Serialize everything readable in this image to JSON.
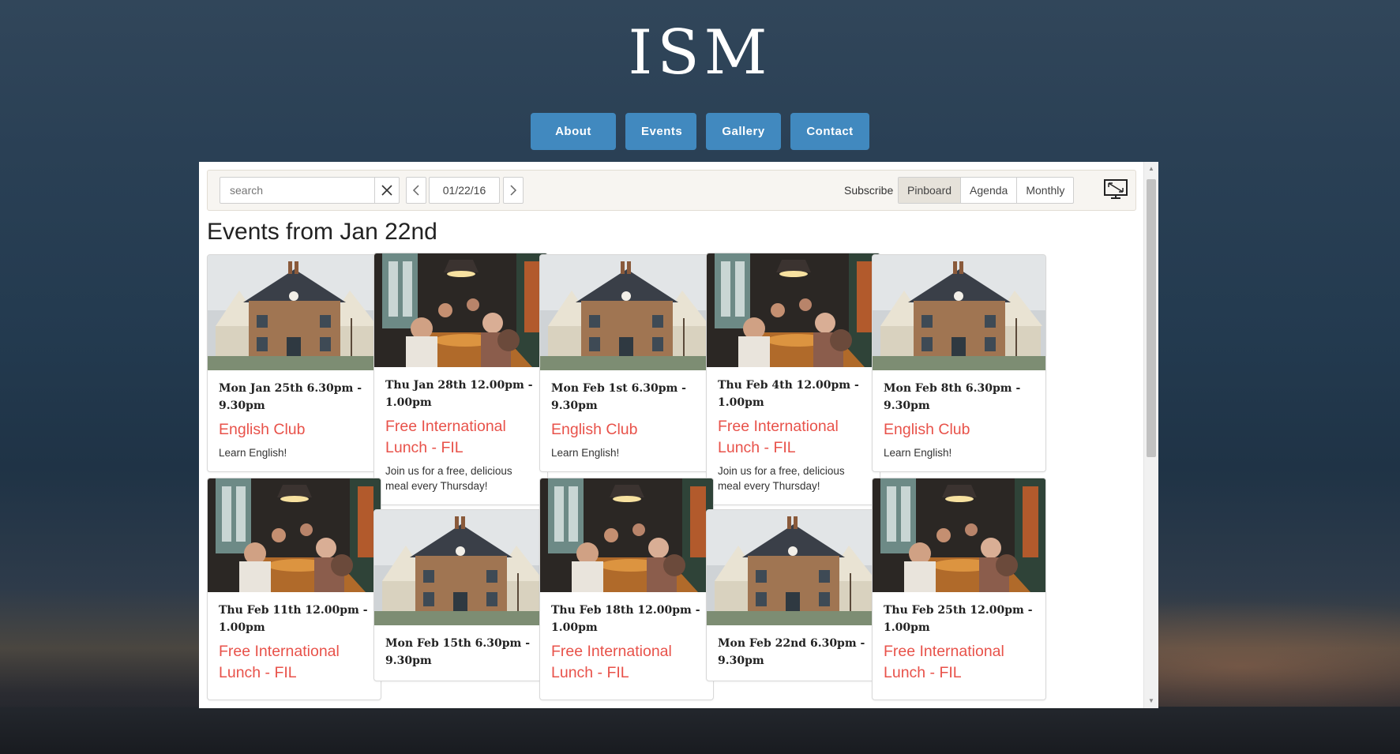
{
  "site": {
    "title": "ISM"
  },
  "nav": {
    "items": [
      "About Us",
      "Events",
      "Gallery",
      "Contact"
    ]
  },
  "toolbar": {
    "search_placeholder": "search",
    "date": "01/22/16",
    "subscribe": "Subscribe",
    "views": [
      "Pinboard",
      "Agenda",
      "Monthly"
    ],
    "active_view": "Pinboard"
  },
  "events": {
    "heading": "Events from Jan 22nd",
    "cards": [
      {
        "date": "Mon Jan 25th 6.30pm - 9.30pm",
        "title": "English Club",
        "desc": "Learn English!",
        "image": "house-photo"
      },
      {
        "date": "Thu Jan 28th 12.00pm - 1.00pm",
        "title": "Free International Lunch - FIL",
        "desc": "Join us for a free, delicious meal every Thursday!",
        "image": "lunch-photo"
      },
      {
        "date": "Mon Feb 1st 6.30pm - 9.30pm",
        "title": "English Club",
        "desc": "Learn English!",
        "image": "house-photo"
      },
      {
        "date": "Thu Feb 4th 12.00pm - 1.00pm",
        "title": "Free International Lunch - FIL",
        "desc": "Join us for a free, delicious meal every Thursday!",
        "image": "lunch-photo"
      },
      {
        "date": "Mon Feb 8th 6.30pm - 9.30pm",
        "title": "English Club",
        "desc": "Learn English!",
        "image": "house-photo"
      },
      {
        "date": "Thu Feb 11th 12.00pm - 1.00pm",
        "title": "Free International Lunch - FIL",
        "desc": "",
        "image": "lunch-photo"
      },
      {
        "date": "Mon Feb 15th 6.30pm - 9.30pm",
        "title": "",
        "desc": "",
        "image": "house-photo"
      },
      {
        "date": "Thu Feb 18th 12.00pm - 1.00pm",
        "title": "Free International Lunch - FIL",
        "desc": "",
        "image": "lunch-photo"
      },
      {
        "date": "Mon Feb 22nd 6.30pm - 9.30pm",
        "title": "",
        "desc": "",
        "image": "house-photo"
      },
      {
        "date": "Thu Feb 25th 12.00pm - 1.00pm",
        "title": "Free International Lunch - FIL",
        "desc": "",
        "image": "lunch-photo"
      }
    ]
  },
  "colors": {
    "nav_button": "#4189bf",
    "event_title": "#e8524a"
  }
}
